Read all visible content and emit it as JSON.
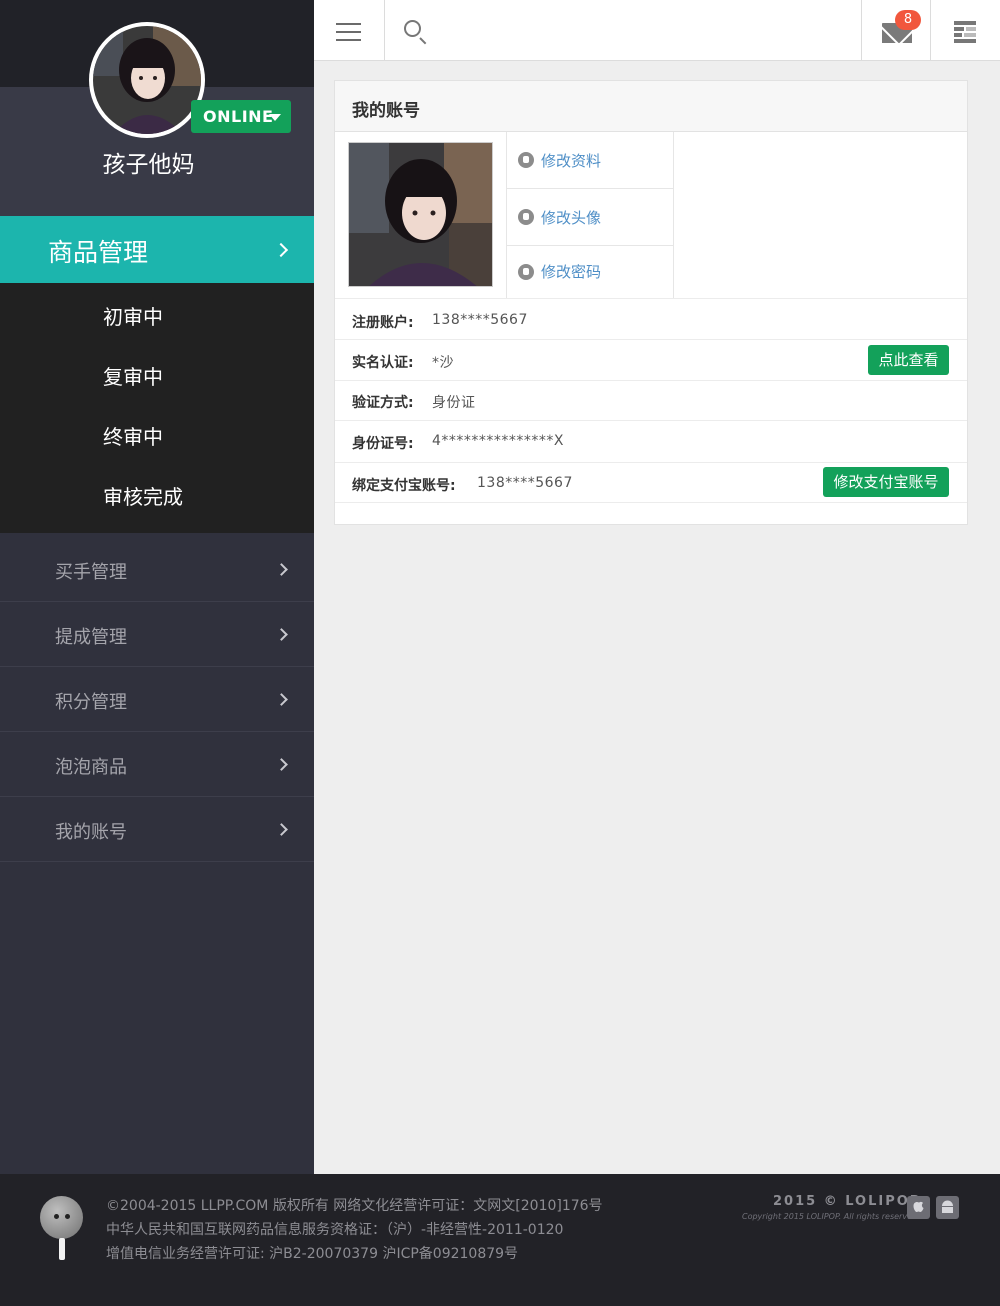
{
  "sidebar": {
    "username": "孩子他妈",
    "status": "ONLINE",
    "active_menu": "商品管理",
    "submenu": [
      "初审中",
      "复审中",
      "终审中",
      "审核完成"
    ],
    "menu": [
      "买手管理",
      "提成管理",
      "积分管理",
      "泡泡商品",
      "我的账号"
    ]
  },
  "topbar": {
    "mail_count": "8"
  },
  "panel": {
    "title": "我的账号",
    "actions": [
      "修改资料",
      "修改头像",
      "修改密码"
    ],
    "rows": [
      {
        "key": "注册账户:",
        "value": "138****5667"
      },
      {
        "key": "实名认证:",
        "value": "*沙",
        "button": "点此查看"
      },
      {
        "key": "验证方式:",
        "value": "身份证"
      },
      {
        "key": "身份证号:",
        "value": "4***************X"
      },
      {
        "key": "绑定支付宝账号:",
        "value": "138****5667",
        "button": "修改支付宝账号"
      }
    ]
  },
  "footer": {
    "line1": "©2004-2015 LLPP.COM 版权所有 网络文化经营许可证：文网文[2010]176号",
    "line2": "中华人民共和国互联网药品信息服务资格证：（沪）-非经营性-2011-0120",
    "line3": "增值电信业务经营许可证: 沪B2-20070379 沪ICP备09210879号",
    "brand": "2015 © LOLIPOP",
    "brand_sub": "Copyright 2015 LOLIPOP. All rights reserved."
  },
  "colors": {
    "accent_teal": "#1cb5ad",
    "online_green": "#13a15a",
    "badge_red": "#f1573d",
    "sidebar_bg": "#30313d",
    "footer_bg": "#222227"
  },
  "icons": [
    "hamburger-icon",
    "search-icon",
    "mail-icon",
    "grid-icon",
    "chevron-right-icon",
    "edit-icon",
    "user-icon",
    "key-icon",
    "apple-icon",
    "android-icon"
  ]
}
